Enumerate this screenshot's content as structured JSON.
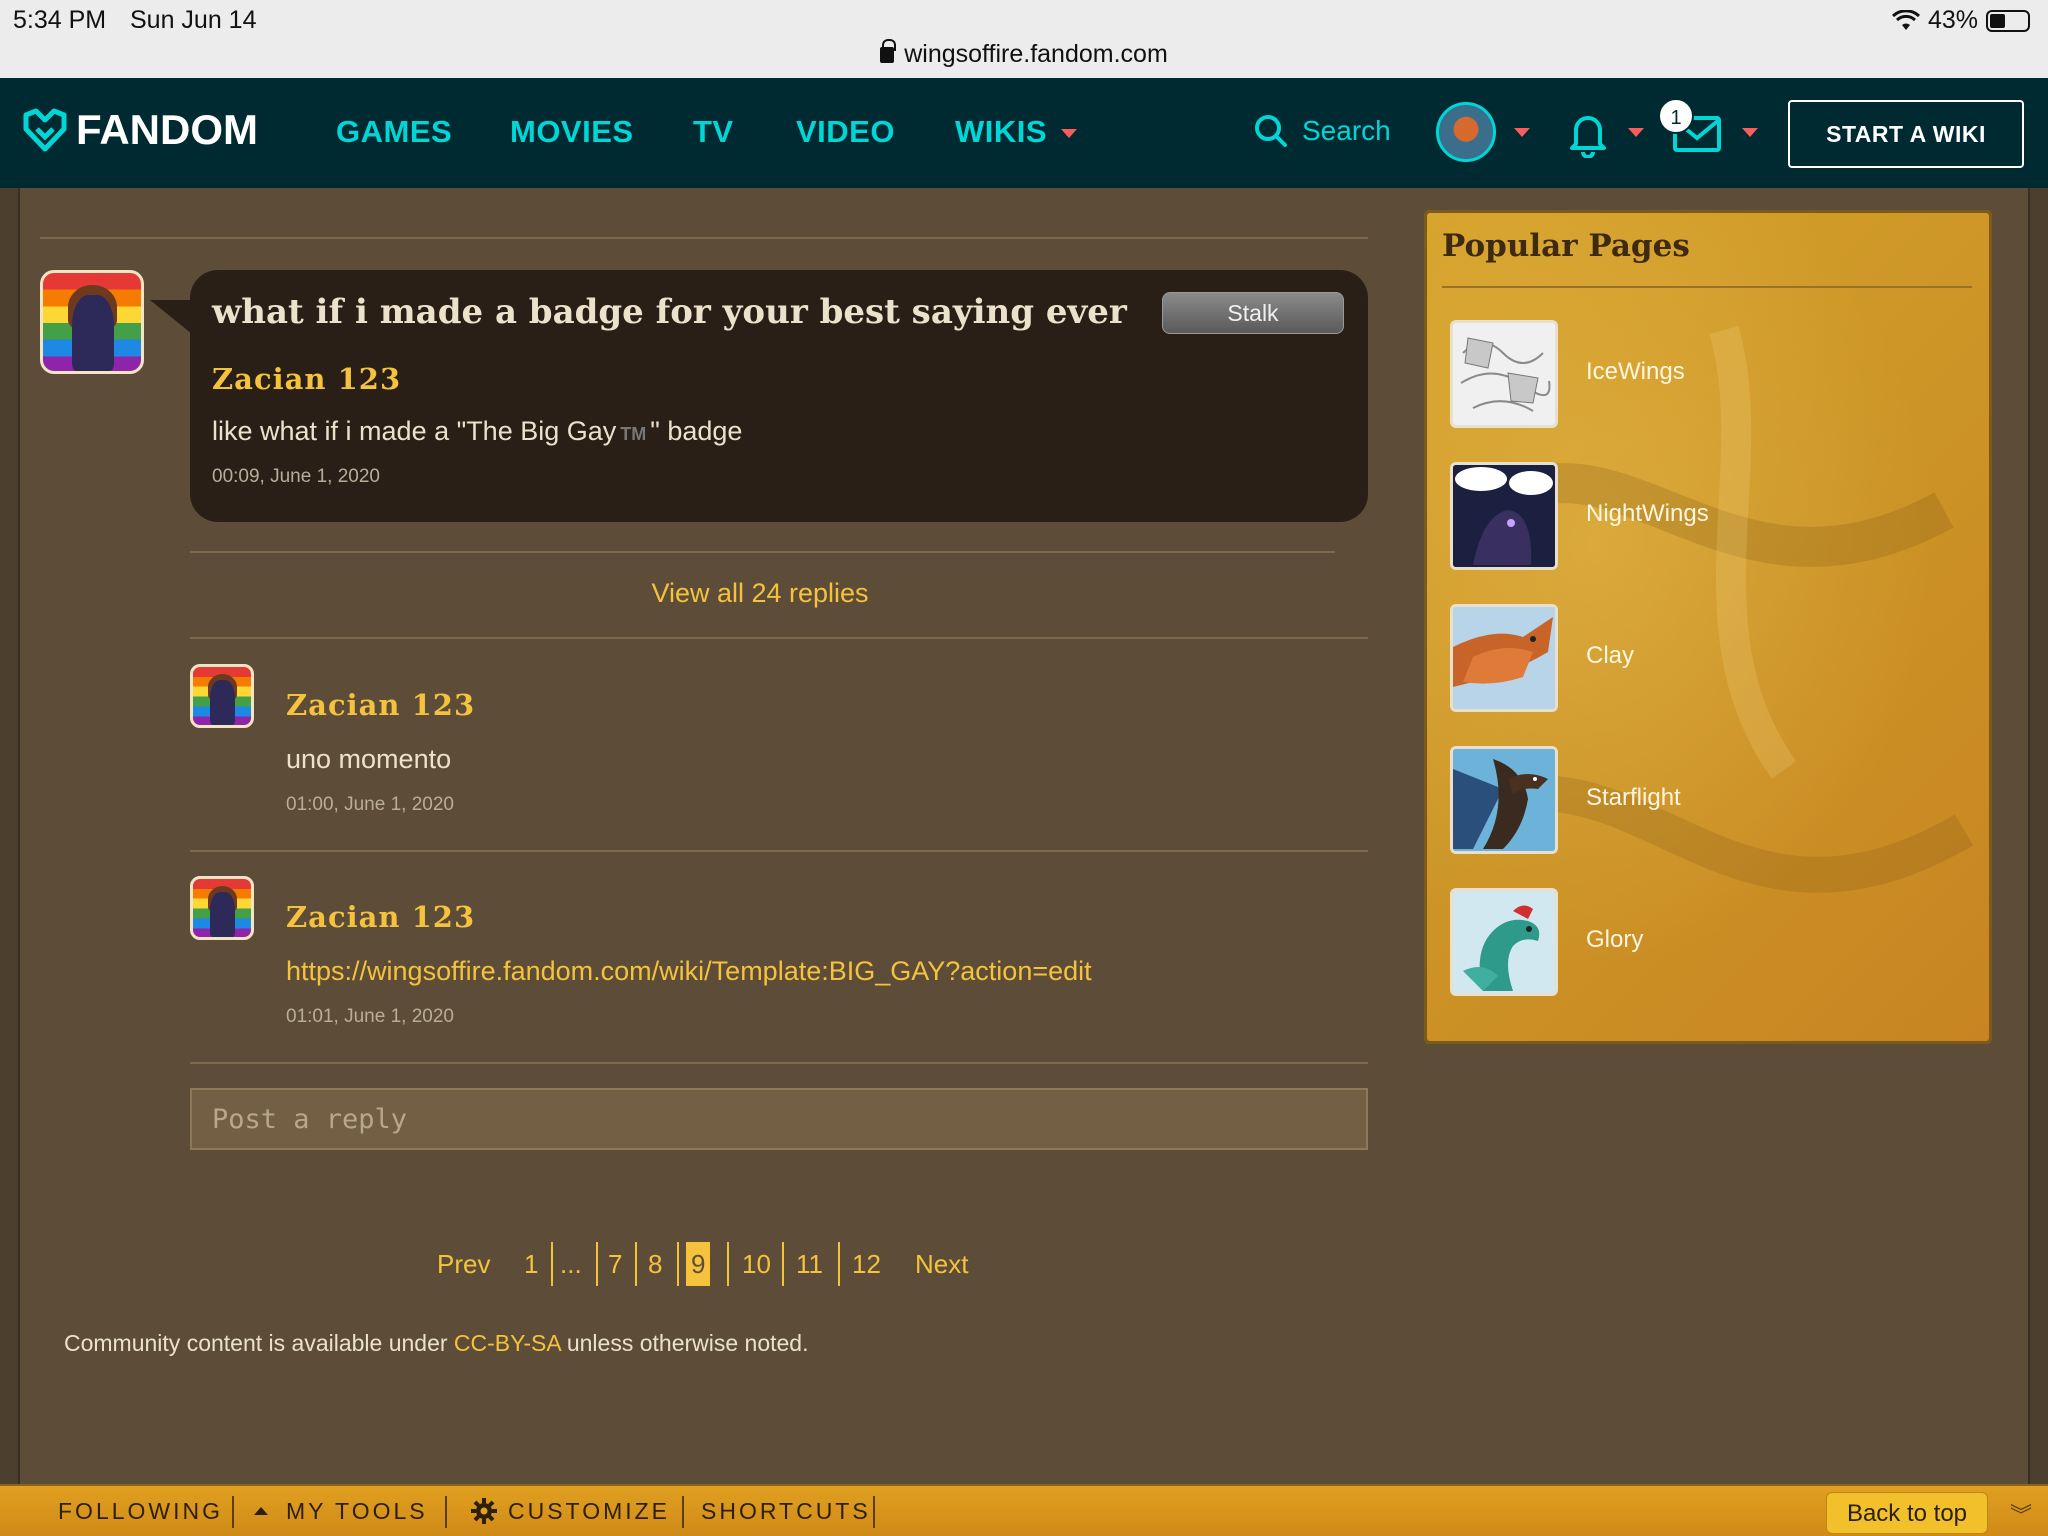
{
  "status_bar": {
    "time": "5:34 PM",
    "date": "Sun Jun 14",
    "url": "wingsoffire.fandom.com",
    "battery": "43%",
    "battery_level": 0.43
  },
  "nav": {
    "logo": "FANDOM",
    "links": [
      "GAMES",
      "MOVIES",
      "TV",
      "VIDEO",
      "WIKIS"
    ],
    "search_label": "Search",
    "message_count": "1",
    "start_wiki": "START A WIKI"
  },
  "thread": {
    "title": "what if i made a badge for your best saying ever",
    "stalk_label": "Stalk",
    "author": "Zacian 123",
    "message_before": "like what if i made a \"The Big Gay",
    "message_tm": "TM",
    "message_after": "\" badge",
    "timestamp": "00:09, June 1, 2020",
    "view_all": "View all 24 replies"
  },
  "replies": [
    {
      "author": "Zacian 123",
      "text": "uno momento",
      "timestamp": "01:00, June 1, 2020"
    },
    {
      "author": "Zacian 123",
      "link": "https://wingsoffire.fandom.com/wiki/Template:BIG_GAY?action=edit",
      "timestamp": "01:01, June 1, 2020"
    }
  ],
  "post_reply_placeholder": "Post a reply",
  "pagination": {
    "prev": "Prev",
    "pages": [
      "1",
      "...",
      "7",
      "8",
      "9",
      "10",
      "11",
      "12"
    ],
    "current": "9",
    "next": "Next"
  },
  "license": {
    "before": "Community content is available under ",
    "link": "CC-BY-SA",
    "after": " unless otherwise noted."
  },
  "sidebar": {
    "title": "Popular Pages",
    "pages": [
      "IceWings",
      "NightWings",
      "Clay",
      "Starflight",
      "Glory"
    ]
  },
  "toolbar": {
    "following": "FOLLOWING",
    "my_tools": "MY TOOLS",
    "customize": "CUSTOMIZE",
    "shortcuts": "SHORTCUTS",
    "back_to_top": "Back to top"
  },
  "colors": {
    "nav_bg": "#002a32",
    "nav_link": "#00d6d6",
    "accent_gold": "#f4c23c",
    "page_bg": "#5d4d38",
    "bubble_bg": "#2a1f16"
  }
}
